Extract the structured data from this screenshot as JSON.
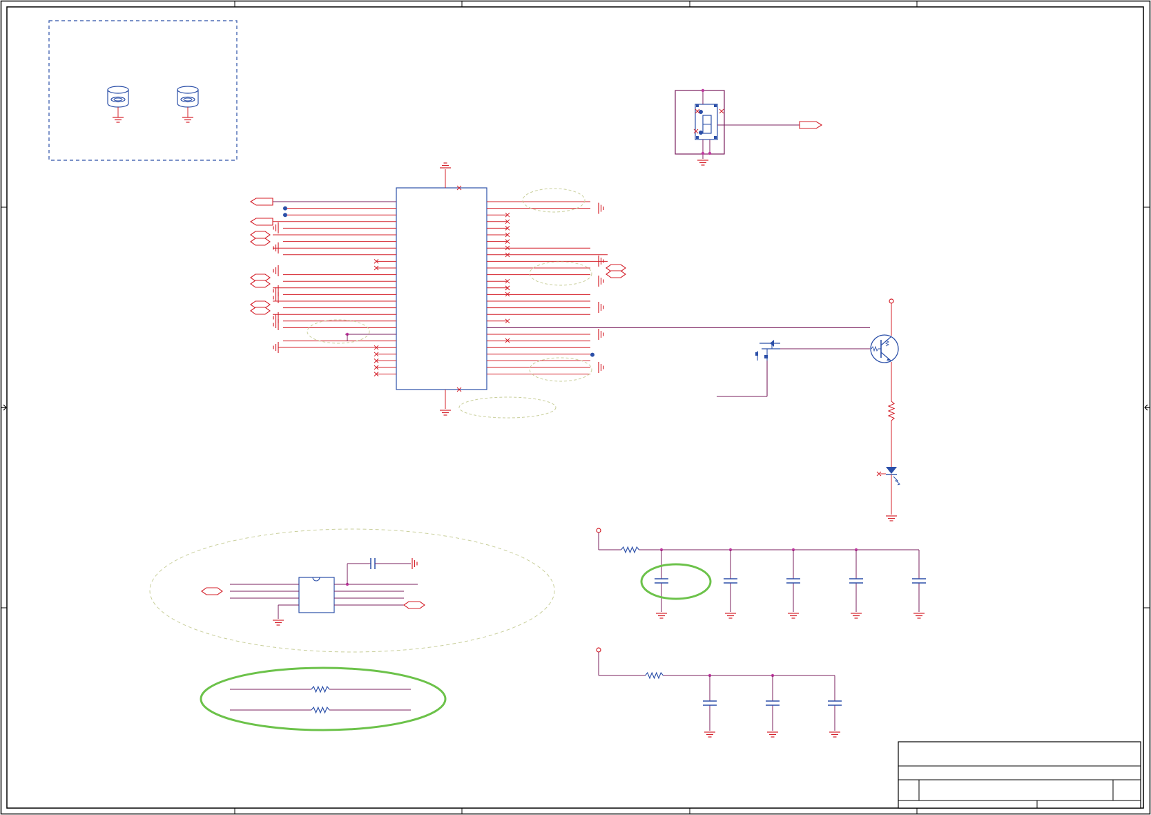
{
  "sheet": {
    "title_block_fields": [
      "",
      "",
      "",
      ""
    ]
  },
  "colors": {
    "wire": "#d4202a",
    "net": "#7a1f5e",
    "part": "#2b4fa8",
    "frame": "#000000",
    "junction": "#c03aa0",
    "highlight": "#6cc24a",
    "annotation": "#c9cf9b",
    "group_box": "#2b4fa8"
  },
  "icons": [
    "mounting-hole-icon",
    "ground-icon",
    "connector-icon",
    "mosfet-icon",
    "transistor-icon",
    "resistor-icon",
    "led-icon",
    "capacitor-icon",
    "ic-icon",
    "port-arrow-icon",
    "no-connect-icon",
    "power-pin-icon"
  ]
}
